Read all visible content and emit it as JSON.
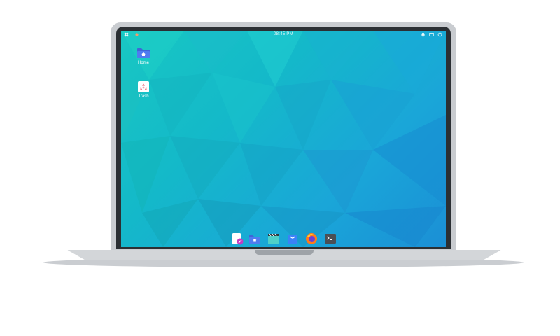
{
  "topbar": {
    "time": "08:45 PM",
    "left_icons": [
      "apps-menu-icon",
      "indicator-dot-icon"
    ],
    "right_icons": [
      "notifications-icon",
      "display-icon",
      "power-icon"
    ]
  },
  "desktop": {
    "items": [
      {
        "label": "Home",
        "icon": "home-folder-icon"
      },
      {
        "label": "Trash",
        "icon": "trash-icon"
      }
    ]
  },
  "dock": {
    "items": [
      {
        "name": "text-editor",
        "icon": "text-editor-icon"
      },
      {
        "name": "files",
        "icon": "files-icon"
      },
      {
        "name": "videos",
        "icon": "video-player-icon"
      },
      {
        "name": "store",
        "icon": "store-icon"
      },
      {
        "name": "firefox",
        "icon": "firefox-icon"
      },
      {
        "name": "terminal",
        "icon": "terminal-icon"
      }
    ],
    "active": "terminal"
  },
  "colors": {
    "wallpaper_start": "#18c7c3",
    "wallpaper_end": "#1b8fd6",
    "folder_blue": "#4f7cf0",
    "laptop_frame": "#c9ccd0",
    "bezel": "#2b2f33"
  }
}
